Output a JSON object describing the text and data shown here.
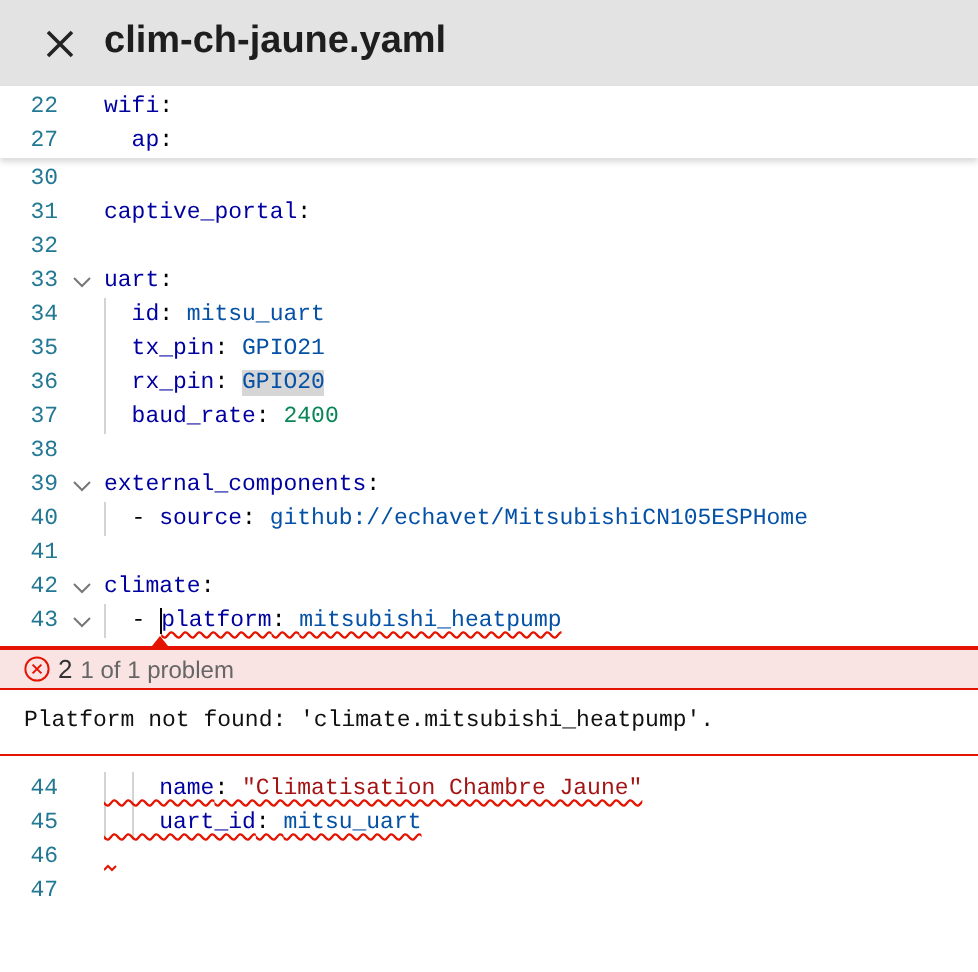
{
  "tab": {
    "title": "clim-ch-jaune.yaml"
  },
  "sticky_lines": [
    {
      "number": "22",
      "foldable": false,
      "tokens": [
        {
          "kind": "key",
          "text": "wifi"
        },
        {
          "kind": "punct",
          "text": ":"
        }
      ]
    },
    {
      "number": "27",
      "foldable": false,
      "tokens": [
        {
          "kind": "key",
          "text": "  ap"
        },
        {
          "kind": "punct",
          "text": ":"
        }
      ]
    }
  ],
  "lines": [
    {
      "number": "30",
      "foldable": false
    },
    {
      "number": "31",
      "foldable": false,
      "tokens": [
        {
          "kind": "key",
          "text": "captive_portal"
        },
        {
          "kind": "punct",
          "text": ":"
        }
      ]
    },
    {
      "number": "32",
      "foldable": false
    },
    {
      "number": "33",
      "foldable": true,
      "tokens": [
        {
          "kind": "key",
          "text": "uart"
        },
        {
          "kind": "punct",
          "text": ":"
        }
      ]
    },
    {
      "number": "34",
      "foldable": false,
      "tokens": [
        {
          "kind": "key",
          "text": "  id"
        },
        {
          "kind": "punct",
          "text": ": "
        },
        {
          "kind": "value",
          "text": "mitsu_uart"
        }
      ]
    },
    {
      "number": "35",
      "foldable": false,
      "tokens": [
        {
          "kind": "key",
          "text": "  tx_pin"
        },
        {
          "kind": "punct",
          "text": ": "
        },
        {
          "kind": "value",
          "text": "GPIO21"
        }
      ]
    },
    {
      "number": "36",
      "foldable": false,
      "tokens": [
        {
          "kind": "key",
          "text": "  rx_pin"
        },
        {
          "kind": "punct",
          "text": ": "
        },
        {
          "kind": "value",
          "text": "GPIO20",
          "highlighted": true
        }
      ]
    },
    {
      "number": "37",
      "foldable": false,
      "tokens": [
        {
          "kind": "key",
          "text": "  baud_rate"
        },
        {
          "kind": "punct",
          "text": ": "
        },
        {
          "kind": "number",
          "text": "2400"
        }
      ]
    },
    {
      "number": "38",
      "foldable": false
    },
    {
      "number": "39",
      "foldable": true,
      "tokens": [
        {
          "kind": "key",
          "text": "external_components"
        },
        {
          "kind": "punct",
          "text": ":"
        }
      ]
    },
    {
      "number": "40",
      "foldable": false,
      "tokens": [
        {
          "kind": "punct",
          "text": "  - "
        },
        {
          "kind": "key",
          "text": "source"
        },
        {
          "kind": "punct",
          "text": ": "
        },
        {
          "kind": "value",
          "text": "github://echavet/MitsubishiCN105ESPHome"
        }
      ]
    },
    {
      "number": "41",
      "foldable": false
    },
    {
      "number": "42",
      "foldable": true,
      "tokens": [
        {
          "kind": "key",
          "text": "climate"
        },
        {
          "kind": "punct",
          "text": ":"
        }
      ]
    },
    {
      "number": "43",
      "foldable": true,
      "tokens": [
        {
          "kind": "punct",
          "text": "  - "
        },
        {
          "kind": "key",
          "text": "platform",
          "error": true,
          "cursor": true
        },
        {
          "kind": "punct",
          "text": ": ",
          "error": true
        },
        {
          "kind": "value",
          "text": "mitsubishi_heatpump",
          "error": true
        }
      ]
    }
  ],
  "problem": {
    "count": "2",
    "summary": "1 of 1 problem",
    "message": "Platform not found: 'climate.mitsubishi_heatpump'."
  },
  "lines_after": [
    {
      "number": "44",
      "foldable": false,
      "tokens": [
        {
          "kind": "key",
          "text": "    name",
          "error": true
        },
        {
          "kind": "punct",
          "text": ": ",
          "error": true
        },
        {
          "kind": "string",
          "text": "\"Climatisation Chambre Jaune\"",
          "error": true
        }
      ]
    },
    {
      "number": "45",
      "foldable": false,
      "tokens": [
        {
          "kind": "key",
          "text": "    uart_id",
          "error": true
        },
        {
          "kind": "punct",
          "text": ": ",
          "error": true
        },
        {
          "kind": "value",
          "text": "mitsu_uart",
          "error": true
        }
      ]
    },
    {
      "number": "46",
      "foldable": false,
      "error_mark": true
    },
    {
      "number": "47",
      "foldable": false
    }
  ]
}
